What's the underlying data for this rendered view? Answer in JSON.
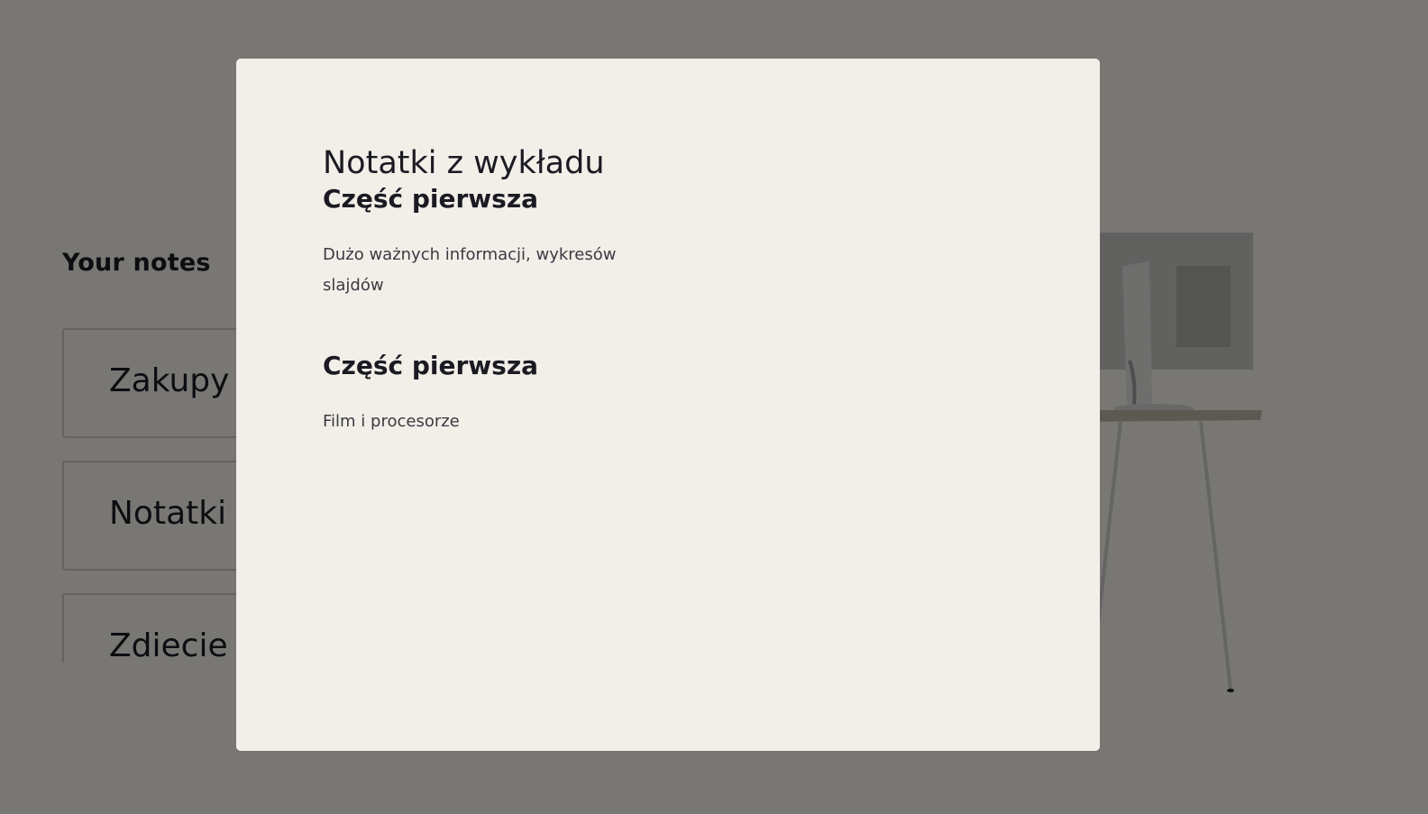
{
  "background": {
    "heading": "Your notes",
    "notes": [
      {
        "title": "Zakupy"
      },
      {
        "title": "Notatki z"
      },
      {
        "title": "Zdiecie z"
      }
    ]
  },
  "modal": {
    "title": "Notatki z wykładu",
    "sections": [
      {
        "heading": "Część pierwsza",
        "body": "Dużo ważnych informacji, wykresów slajdów"
      },
      {
        "heading": "Część pierwsza",
        "body": "Film i procesorze"
      }
    ]
  },
  "colors": {
    "page_background": "#f2efe9",
    "text": "#1b1a22",
    "overlay": "rgba(0,0,0,0.5)"
  }
}
